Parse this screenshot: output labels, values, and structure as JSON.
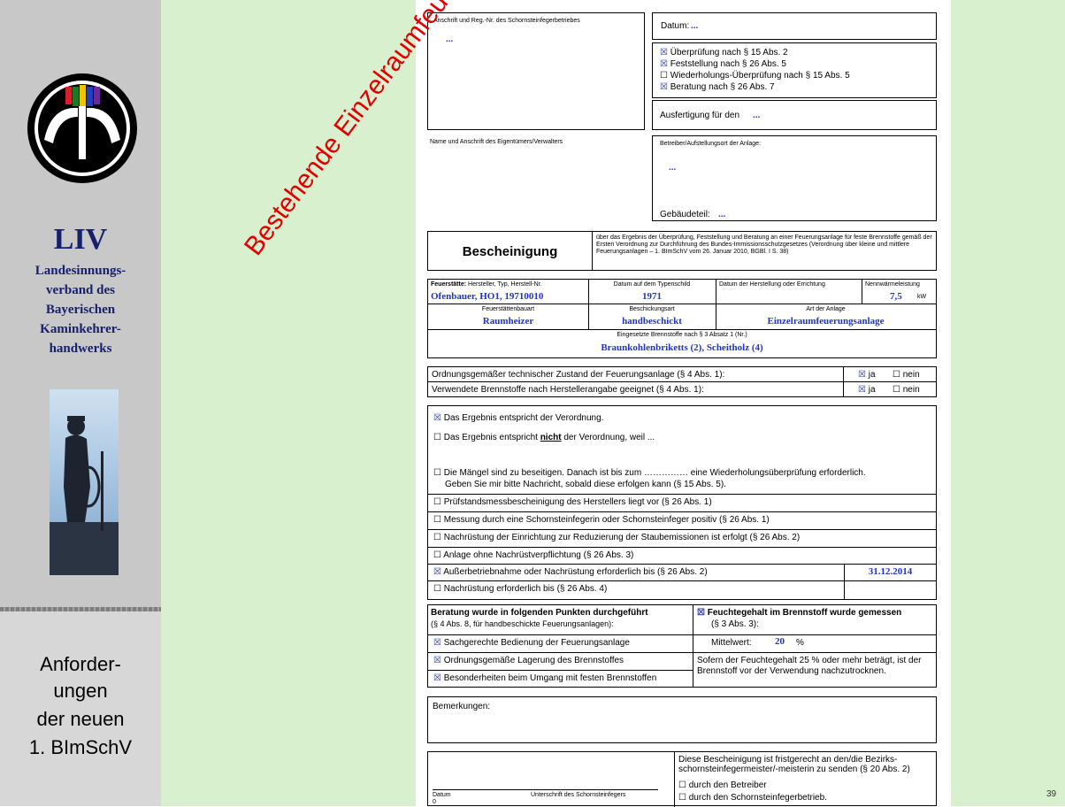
{
  "sidebar": {
    "title": "LIV",
    "lines": [
      "Landesinnungs-",
      "verband des",
      "Bayerischen",
      "Kaminkehrer-",
      "handwerks"
    ],
    "bottom_lines": [
      "Anforder-",
      "ungen",
      "der neuen",
      "1. BImSchV"
    ]
  },
  "stamp": "Bestehende Einzelraumfeuerungsanlage",
  "page_number": "39",
  "form": {
    "address_label": "Anschrift und Reg.-Nr. des Schornsteinfegerbetriebes",
    "address_value": "...",
    "datum_label": "Datum:",
    "datum_value": "...",
    "checks_top": [
      {
        "mark": "☒",
        "label": "Überprüfung nach § 15 Abs. 2"
      },
      {
        "mark": "☒",
        "label": "Feststellung nach § 26 Abs. 5"
      },
      {
        "mark": "☐",
        "label": "Wiederholungs-Überprüfung nach § 15 Abs. 5"
      },
      {
        "mark": "☒",
        "label": "Beratung nach § 26 Abs. 7"
      }
    ],
    "ausfertigung_label": "Ausfertigung für den",
    "ausfertigung_value": "...",
    "owner_label": "Name und Anschrift des Eigentümers/Verwalters",
    "operator_label": "Betreiber/Aufstellungsort der Anlage:",
    "operator_value": "...",
    "gebaeude_label": "Gebäudeteil:",
    "gebaeude_value": "...",
    "bescheinigung_title": "Bescheinigung",
    "bescheinigung_text": "über das Ergebnis der Überprüfung, Feststellung und Beratung an einer Feuerungsanlage für feste Brennstoffe gemäß der Ersten Verordnung zur Durchführung des Bundes-Immissionsschutzgesetzes (Verordnung über kleine und mittlere Feuerungsanlagen – 1. BImSchV vom 26. Januar 2010, BGBl. I S. 38)",
    "feuerstaette_label_bold": "Feuerstätte:",
    "feuerstaette_label": "Hersteller, Typ, Herstell-Nr.",
    "feuerstaette_value": "Ofenbauer, HO1, 19710010",
    "typenschild_label": "Datum auf dem Typenschild",
    "typenschild_value": "1971",
    "herstellung_label": "Datum der Herstellung oder Errichtung",
    "nennwaerme_label": "Nennwärmeleistung",
    "nennwaerme_value": "7,5",
    "nennwaerme_unit": "kW",
    "bauart_label": "Feuerstättenbauart",
    "bauart_value": "Raumheizer",
    "beschickung_label": "Beschickungsart",
    "beschickung_value": "handbeschickt",
    "anlage_label": "Art der Anlage",
    "anlage_value": "Einzelraumfeuerungsanlage",
    "brennstoffe_label": "Eingesetzte Brennstoffe nach § 3 Absatz 1 (Nr.)",
    "brennstoffe_value": "Braunkohlenbriketts (2), Scheitholz (4)",
    "zustand_label": "Ordnungsgemäßer technischer Zustand der Feuerungsanlage (§ 4 Abs. 1):",
    "geeignet_label": "Verwendete Brennstoffe nach Herstellerangabe geeignet (§ 4 Abs. 1):",
    "ja_mark": "☒",
    "ja_label": "ja",
    "nein_mark": "☐",
    "nein_label": "nein",
    "ergebnis_ok": "Das Ergebnis entspricht der Verordnung.",
    "ergebnis_nicht_pre": "Das Ergebnis entspricht",
    "ergebnis_nicht_word": "nicht",
    "ergebnis_nicht_post": "der Verordnung, weil ...",
    "maengel_line1": "Die Mängel sind zu beseitigen. Danach ist bis zum …………… eine Wiederholungsüberprüfung erforderlich.",
    "maengel_line2": "Geben Sie mir bitte Nachricht, sobald diese erfolgen kann (§ 15 Abs. 5).",
    "rows": [
      {
        "mark": "☐",
        "label": "Prüfstandsmessbescheinigung des Herstellers liegt vor (§ 26 Abs. 1)"
      },
      {
        "mark": "☐",
        "label": "Messung durch eine Schornsteinfegerin oder Schornsteinfeger positiv (§ 26 Abs. 1)"
      },
      {
        "mark": "☐",
        "label": "Nachrüstung der Einrichtung zur Reduzierung der Staubemissionen ist erfolgt (§ 26 Abs. 2)"
      },
      {
        "mark": "☐",
        "label": "Anlage ohne Nachrüstverpflichtung (§ 26 Abs. 3)"
      },
      {
        "mark": "☒",
        "label": "Außerbetriebnahme oder Nachrüstung erforderlich bis (§ 26 Abs. 2)",
        "value": "31.12.2014"
      },
      {
        "mark": "☐",
        "label": "Nachrüstung erforderlich bis (§ 26 Abs. 4)",
        "value": ""
      }
    ],
    "beratung_title": "Beratung wurde in folgenden Punkten durchgeführt",
    "beratung_sub": "(§ 4 Abs. 8, für handbeschickte Feuerungsanlagen):",
    "beratung_items": [
      {
        "mark": "☒",
        "label": "Sachgerechte Bedienung der Feuerungsanlage"
      },
      {
        "mark": "☒",
        "label": "Ordnungsgemäße Lagerung des Brennstoffes"
      },
      {
        "mark": "☒",
        "label": "Besonderheiten beim Umgang mit festen Brennstoffen"
      }
    ],
    "feuchte_mark": "☒",
    "feuchte_title": "Feuchtegehalt im Brennstoff wurde gemessen",
    "feuchte_sub": "(§ 3 Abs. 3):",
    "mittelwert_label": "Mittelwert:",
    "mittelwert_value": "20",
    "mittelwert_unit": "%",
    "feuchte_note": "Sofern der Feuchtegehalt 25 % oder mehr beträgt, ist der Brennstoff vor der Verwendung nachzutrocknen.",
    "bemerkungen_label": "Bemerkungen:",
    "datum_footer": "Datum",
    "datum_footer_value": "0",
    "unterschrift_label": "Unterschrift des Schornsteinfegers",
    "frist_text": "Diese Bescheinigung ist fristgerecht an den/die Bezirks-schornsteinfegermeister/-meisterin zu senden (§ 20 Abs. 2)",
    "frist_options": [
      {
        "mark": "☐",
        "label": "durch den Betreiber"
      },
      {
        "mark": "☐",
        "label": "durch den Schornsteinfegerbetrieb."
      }
    ]
  }
}
